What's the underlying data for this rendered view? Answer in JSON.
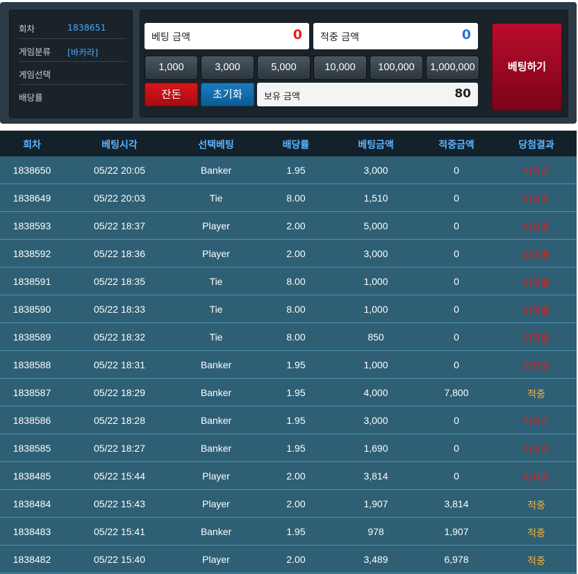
{
  "info": {
    "round_label": "회차",
    "round_value": "1838651",
    "category_label": "게임분류",
    "category_value": "[바카라]",
    "selection_label": "게임선택",
    "selection_value": "",
    "odds_label": "배당률",
    "odds_value": ""
  },
  "bet": {
    "bet_amount_label": "베팅 금액",
    "bet_amount_value": "0",
    "win_amount_label": "적중 금액",
    "win_amount_value": "0",
    "chips": [
      "1,000",
      "3,000",
      "5,000",
      "10,000",
      "100,000",
      "1,000,000"
    ],
    "change_label": "잔돈",
    "reset_label": "초기화",
    "holding_label": "보유 금액",
    "holding_value": "80",
    "bet_button_label": "베팅하기"
  },
  "colors": {
    "lose": "#e0201e",
    "win": "#f5b63c",
    "header_text": "#5fb3ff"
  },
  "table": {
    "headers": [
      "회차",
      "베팅시각",
      "선택베팅",
      "배당률",
      "베팅금액",
      "적중금액",
      "당첨결과"
    ],
    "rows": [
      {
        "round": "1838650",
        "time": "05/22 20:05",
        "pick": "Banker",
        "odds": "1.95",
        "bet": "3,000",
        "win": "0",
        "result": "미적중",
        "status": "lose"
      },
      {
        "round": "1838649",
        "time": "05/22 20:03",
        "pick": "Tie",
        "odds": "8.00",
        "bet": "1,510",
        "win": "0",
        "result": "미적중",
        "status": "lose"
      },
      {
        "round": "1838593",
        "time": "05/22 18:37",
        "pick": "Player",
        "odds": "2.00",
        "bet": "5,000",
        "win": "0",
        "result": "미적중",
        "status": "lose"
      },
      {
        "round": "1838592",
        "time": "05/22 18:36",
        "pick": "Player",
        "odds": "2.00",
        "bet": "3,000",
        "win": "0",
        "result": "미적중",
        "status": "lose"
      },
      {
        "round": "1838591",
        "time": "05/22 18:35",
        "pick": "Tie",
        "odds": "8.00",
        "bet": "1,000",
        "win": "0",
        "result": "미적중",
        "status": "lose"
      },
      {
        "round": "1838590",
        "time": "05/22 18:33",
        "pick": "Tie",
        "odds": "8.00",
        "bet": "1,000",
        "win": "0",
        "result": "미적중",
        "status": "lose"
      },
      {
        "round": "1838589",
        "time": "05/22 18:32",
        "pick": "Tie",
        "odds": "8.00",
        "bet": "850",
        "win": "0",
        "result": "미적중",
        "status": "lose"
      },
      {
        "round": "1838588",
        "time": "05/22 18:31",
        "pick": "Banker",
        "odds": "1.95",
        "bet": "1,000",
        "win": "0",
        "result": "미적중",
        "status": "lose"
      },
      {
        "round": "1838587",
        "time": "05/22 18:29",
        "pick": "Banker",
        "odds": "1.95",
        "bet": "4,000",
        "win": "7,800",
        "result": "적중",
        "status": "win"
      },
      {
        "round": "1838586",
        "time": "05/22 18:28",
        "pick": "Banker",
        "odds": "1.95",
        "bet": "3,000",
        "win": "0",
        "result": "미적중",
        "status": "lose"
      },
      {
        "round": "1838585",
        "time": "05/22 18:27",
        "pick": "Banker",
        "odds": "1.95",
        "bet": "1,690",
        "win": "0",
        "result": "미적중",
        "status": "lose"
      },
      {
        "round": "1838485",
        "time": "05/22 15:44",
        "pick": "Player",
        "odds": "2.00",
        "bet": "3,814",
        "win": "0",
        "result": "미적중",
        "status": "lose"
      },
      {
        "round": "1838484",
        "time": "05/22 15:43",
        "pick": "Player",
        "odds": "2.00",
        "bet": "1,907",
        "win": "3,814",
        "result": "적중",
        "status": "win"
      },
      {
        "round": "1838483",
        "time": "05/22 15:41",
        "pick": "Banker",
        "odds": "1.95",
        "bet": "978",
        "win": "1,907",
        "result": "적중",
        "status": "win"
      },
      {
        "round": "1838482",
        "time": "05/22 15:40",
        "pick": "Player",
        "odds": "2.00",
        "bet": "3,489",
        "win": "6,978",
        "result": "적중",
        "status": "win"
      }
    ]
  }
}
